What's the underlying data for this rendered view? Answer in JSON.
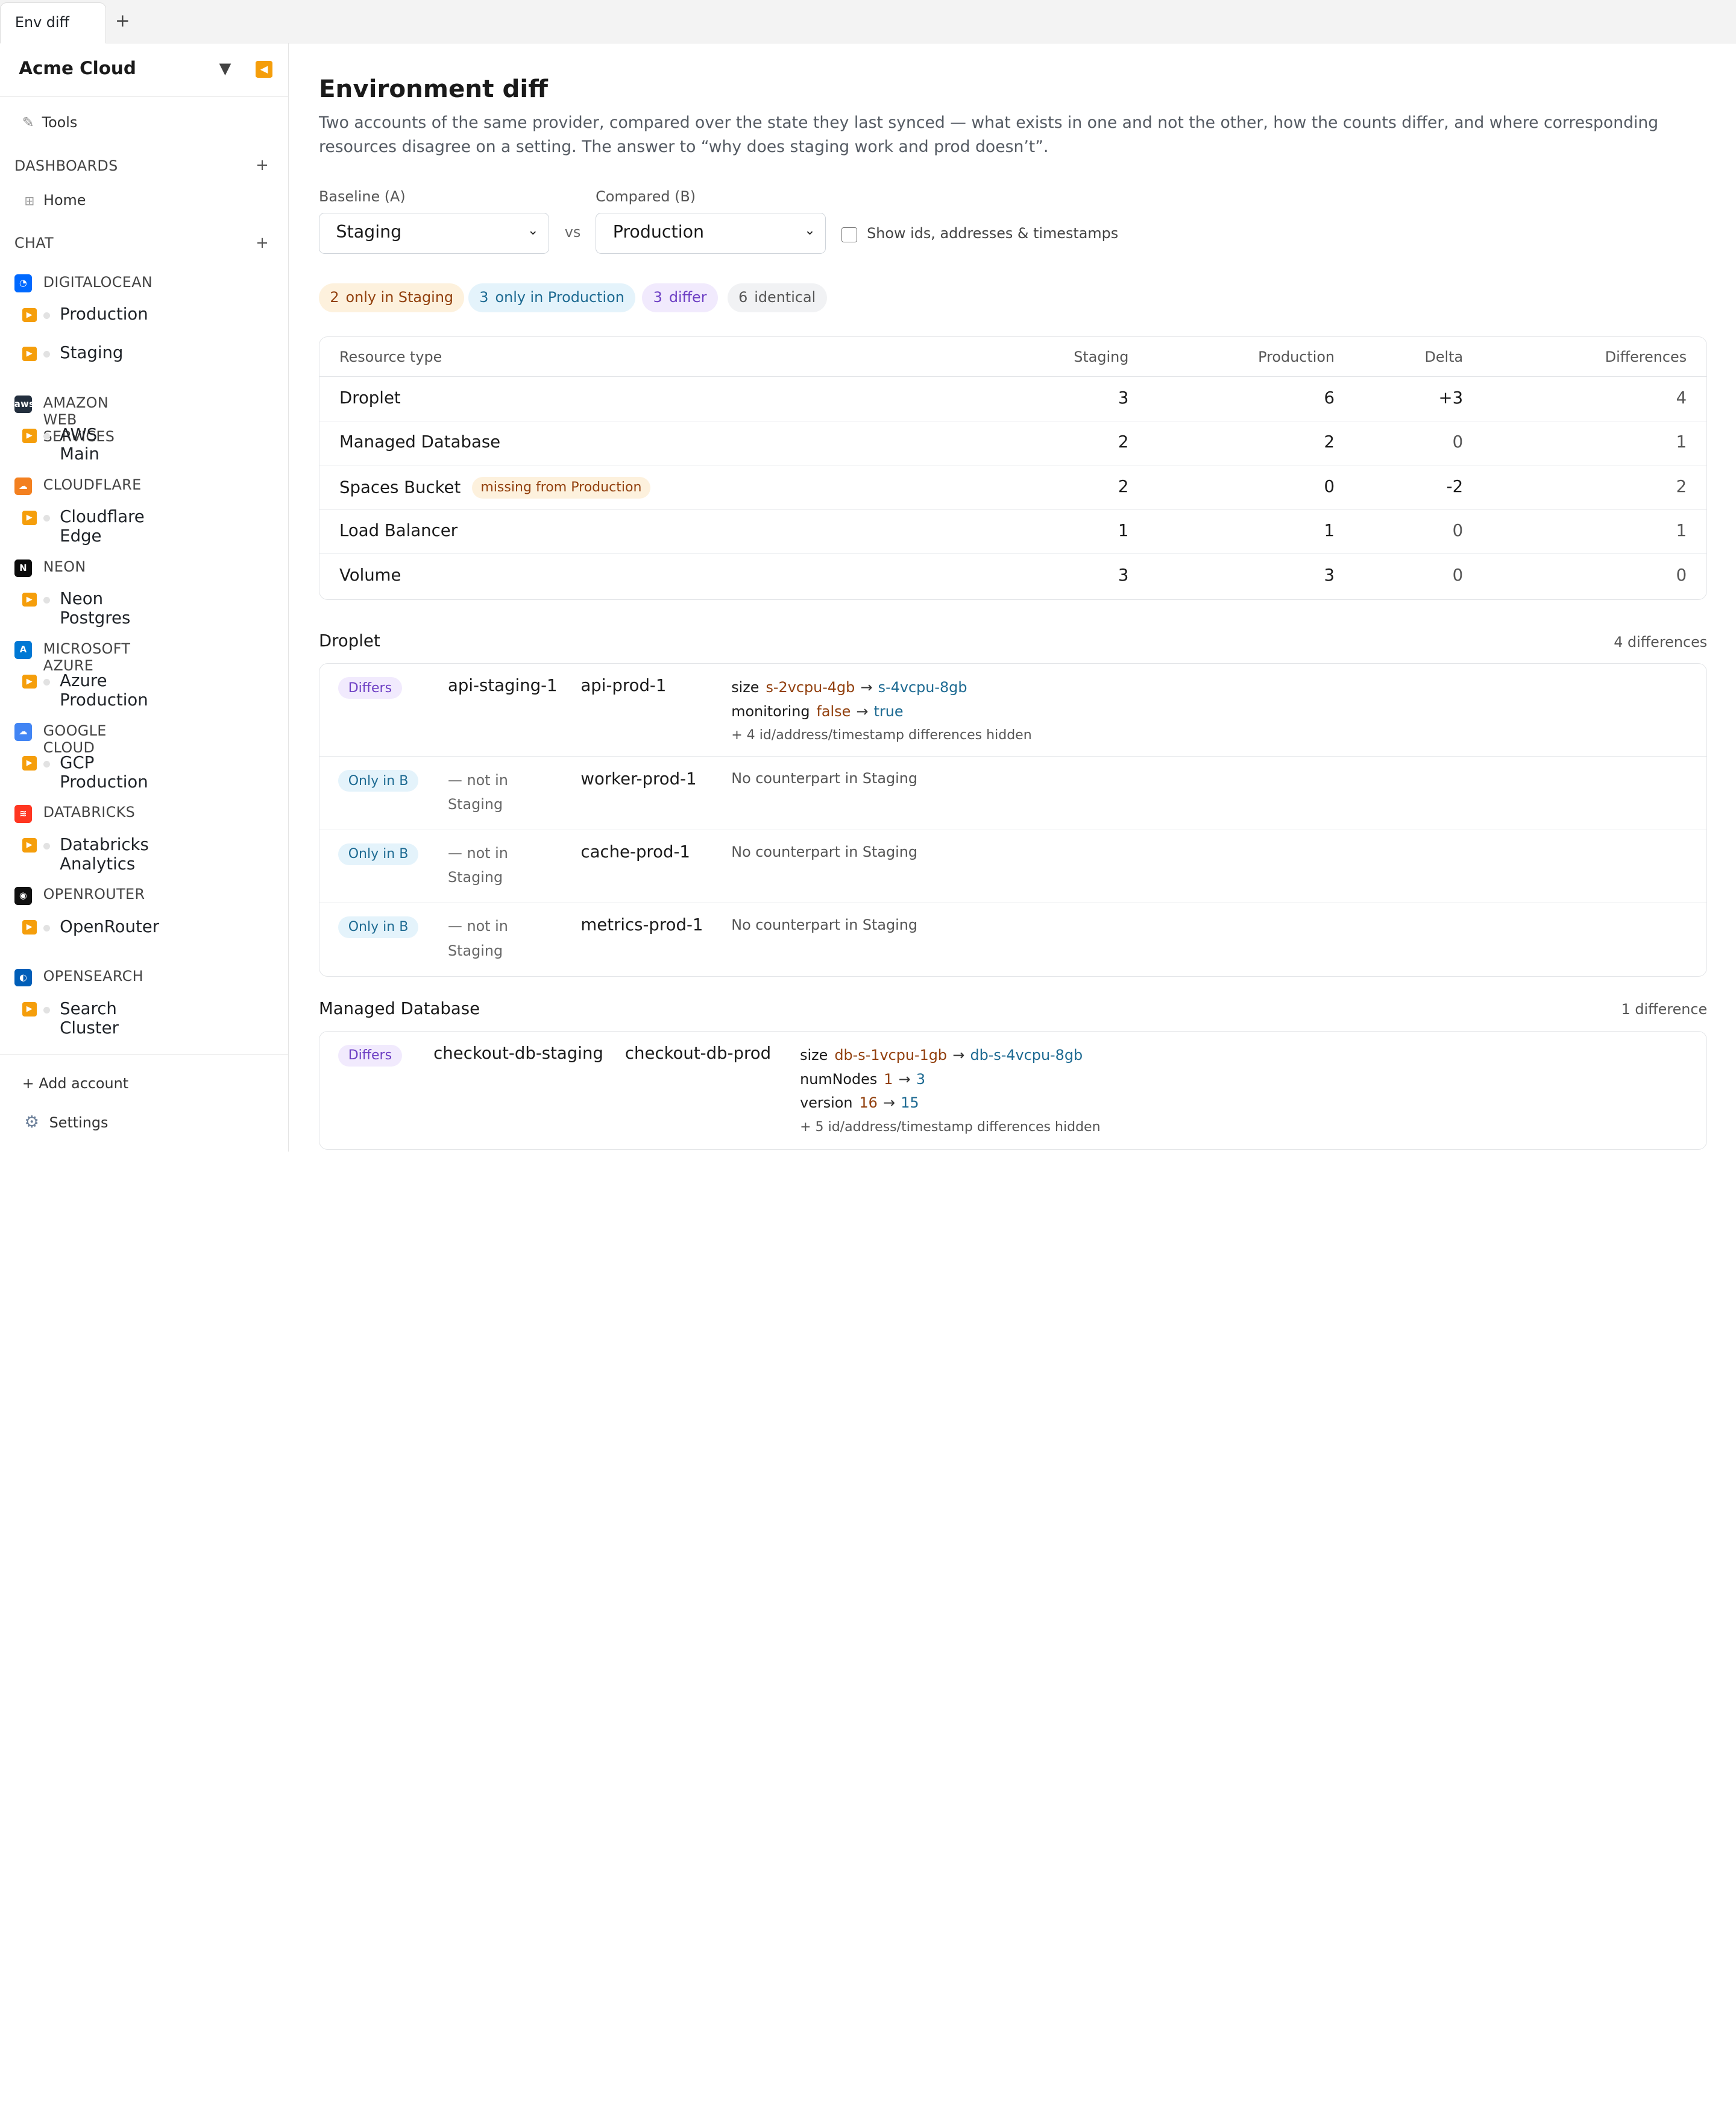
{
  "tab": {
    "label": "Env diff",
    "add": "+"
  },
  "sidebar": {
    "org": "Acme Cloud",
    "tools": "Tools",
    "dashboards_header": "DASHBOARDS",
    "home": "Home",
    "chat_header": "CHAT",
    "providers": [
      {
        "name": "DIGITALOCEAN",
        "logo": "digitalocean-logo",
        "color": "#0069ff",
        "accounts": [
          "Production",
          "Staging"
        ]
      },
      {
        "name": "AMAZON WEB SERVICES",
        "logo": "aws-logo",
        "color": "#232f3e",
        "accounts": [
          "AWS Main"
        ]
      },
      {
        "name": "CLOUDFLARE",
        "logo": "cloudflare-logo",
        "color": "#f38020",
        "accounts": [
          "Cloudflare Edge"
        ]
      },
      {
        "name": "NEON",
        "logo": "neon-logo",
        "color": "#0b0b0b",
        "accounts": [
          "Neon Postgres"
        ]
      },
      {
        "name": "MICROSOFT AZURE",
        "logo": "azure-logo",
        "color": "#0078d4",
        "accounts": [
          "Azure Production"
        ]
      },
      {
        "name": "GOOGLE CLOUD",
        "logo": "google-cloud-logo",
        "color": "#4285f4",
        "accounts": [
          "GCP Production"
        ]
      },
      {
        "name": "DATABRICKS",
        "logo": "databricks-logo",
        "color": "#ff3621",
        "accounts": [
          "Databricks Analytics"
        ]
      },
      {
        "name": "OPENROUTER",
        "logo": "openrouter-logo",
        "color": "#111111",
        "accounts": [
          "OpenRouter"
        ]
      },
      {
        "name": "OPENSEARCH",
        "logo": "opensearch-logo",
        "color": "#005eb8",
        "accounts": [
          "Search Cluster"
        ]
      }
    ],
    "add_account": "Add account",
    "settings": "Settings"
  },
  "main": {
    "title": "Environment diff",
    "description": "Two accounts of the same provider, compared over the state they last synced — what exists in one and not the other, how the counts differ, and where corresponding resources disagree on a setting. The answer to “why does staging work and prod doesn’t”.",
    "baseline_label": "Baseline (A)",
    "baseline_value": "Staging",
    "compared_label": "Compared (B)",
    "compared_value": "Production",
    "vs": "vs",
    "checkbox_label": "Show ids, addresses & timestamps",
    "checkbox_checked": false,
    "summary": [
      {
        "n": "2",
        "label": "only in Staging",
        "bg": "#fdf1dd",
        "fg": "#92400e"
      },
      {
        "n": "3",
        "label": "only in Production",
        "bg": "#e4f3fb",
        "fg": "#1d6a92"
      },
      {
        "n": "3",
        "label": "differ",
        "bg": "#f1eafd",
        "fg": "#6d3fc4"
      },
      {
        "n": "6",
        "label": "identical",
        "bg": "#f1f2f4",
        "fg": "#555555"
      }
    ],
    "table": {
      "headers": [
        "Resource type",
        "Staging",
        "Production",
        "Delta",
        "Differences"
      ],
      "rows": [
        {
          "type": "Droplet",
          "a": "3",
          "b": "6",
          "delta": "+3",
          "diff": "4",
          "badge": ""
        },
        {
          "type": "Managed Database",
          "a": "2",
          "b": "2",
          "delta": "0",
          "diff": "1",
          "badge": ""
        },
        {
          "type": "Spaces Bucket",
          "a": "2",
          "b": "0",
          "delta": "-2",
          "diff": "2",
          "badge": "missing from Production"
        },
        {
          "type": "Load Balancer",
          "a": "1",
          "b": "1",
          "delta": "0",
          "diff": "1",
          "badge": ""
        },
        {
          "type": "Volume",
          "a": "3",
          "b": "3",
          "delta": "0",
          "diff": "0",
          "badge": ""
        }
      ]
    },
    "groups": [
      {
        "title": "Droplet",
        "count": "4 differences",
        "rows": [
          {
            "status": "Differs",
            "a": "api-staging-1",
            "b": "api-prod-1",
            "attrs": [
              {
                "k": "size",
                "a": "s-2vcpu-4gb",
                "b": "s-4vcpu-8gb"
              },
              {
                "k": "monitoring",
                "a": "false",
                "b": "true"
              }
            ],
            "hidden": "+ 4 id/address/timestamp differences hidden"
          },
          {
            "status": "Only in B",
            "a": "— not in Staging",
            "b": "worker-prod-1",
            "note": "No counterpart in Staging"
          },
          {
            "status": "Only in B",
            "a": "— not in Staging",
            "b": "cache-prod-1",
            "note": "No counterpart in Staging"
          },
          {
            "status": "Only in B",
            "a": "— not in Staging",
            "b": "metrics-prod-1",
            "note": "No counterpart in Staging"
          }
        ]
      },
      {
        "title": "Managed Database",
        "count": "1 difference",
        "rows": [
          {
            "status": "Differs",
            "a": "checkout-db-staging",
            "b": "checkout-db-prod",
            "attrs": [
              {
                "k": "size",
                "a": "db-s-1vcpu-1gb",
                "b": "db-s-4vcpu-8gb"
              },
              {
                "k": "numNodes",
                "a": "1",
                "b": "3"
              },
              {
                "k": "version",
                "a": "16",
                "b": "15"
              }
            ],
            "hidden": "+ 5 id/address/timestamp differences hidden"
          }
        ]
      }
    ]
  }
}
